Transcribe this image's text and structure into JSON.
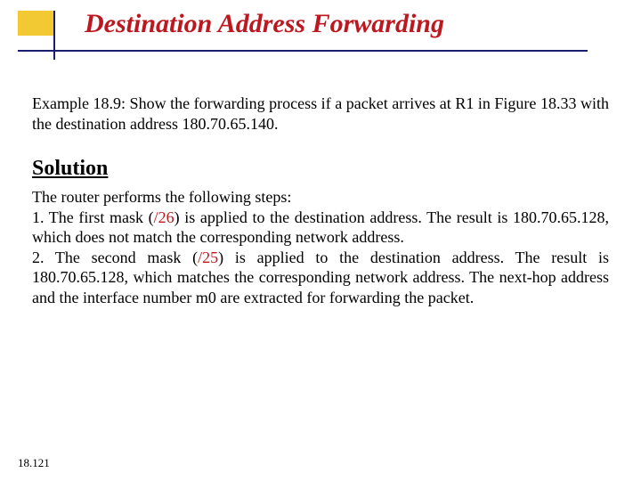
{
  "title": "Destination Address Forwarding",
  "example": "Example 18.9: Show the forwarding process if a packet arrives at R1 in Figure 18.33 with the destination address 180.70.65.140.",
  "solution_heading": "Solution",
  "steps_intro": "The router performs the following steps:",
  "step1_a": "1. The first mask (",
  "mask26": "/26",
  "step1_b": ") is applied to the destination address. The result is 180.70.65.128, which does not match the corresponding network address.",
  "step2_a": "2. The second mask (",
  "mask25": "/25",
  "step2_b": ") is applied to the destination address. The result is 180.70.65.128, which matches the corresponding network address. The next-hop address and the interface number m0 are extracted for forwarding the packet.",
  "page_number": "18.121"
}
